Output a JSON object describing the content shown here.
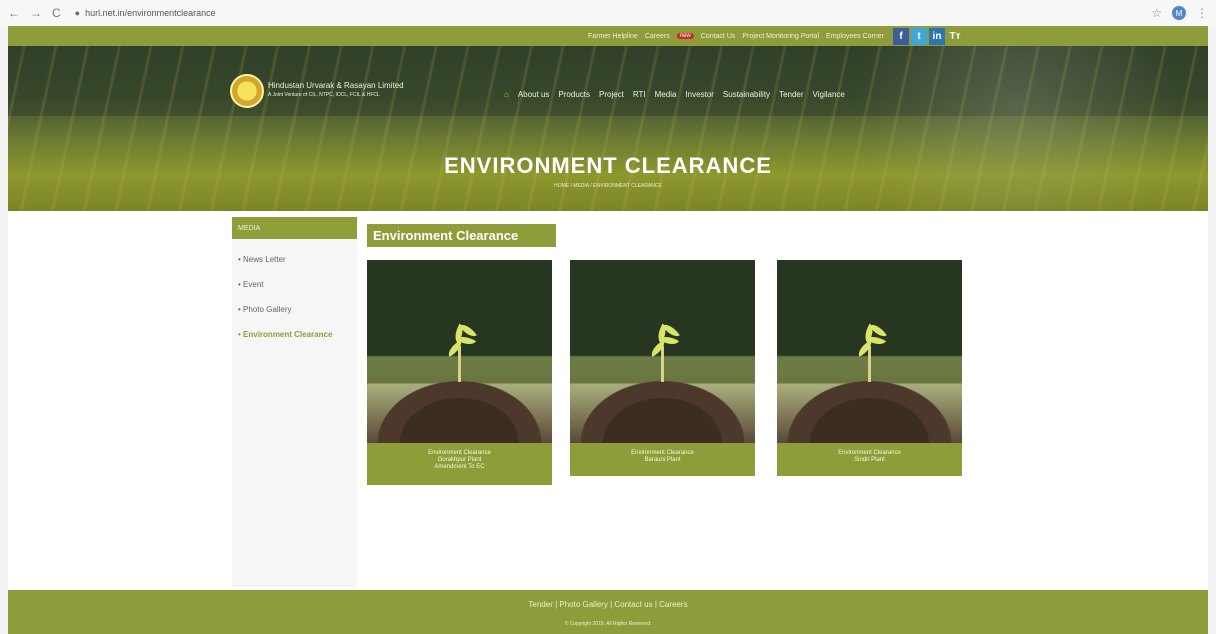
{
  "browser": {
    "url": "hurl.net.in/environmentclearance",
    "star": "☆",
    "avatar": "M",
    "menu": "⋮",
    "nav": [
      "←",
      "→",
      "C"
    ]
  },
  "topbar": {
    "items": [
      "Farmer Helpline",
      "Careers",
      "Contact Us",
      "Project Monitoring Portal",
      "Employees Corner"
    ],
    "badge": "new"
  },
  "social": {
    "facebook": "f",
    "twitter": "t",
    "linkedin": "in",
    "text": "Tт"
  },
  "company": {
    "name": "Hindustan Urvarak & Rasayan Limited",
    "tagline": "A Joint Venture of CIL, NTPC, IOCL, FCIL & HFCL"
  },
  "nav": {
    "home_icon": "⌂",
    "items": [
      "About us",
      "Products",
      "Project",
      "RTI",
      "Media",
      "Investor",
      "Sustainability",
      "Tender",
      "Vigilance"
    ]
  },
  "hero": {
    "title": "ENVIRONMENT CLEARANCE",
    "breadcrumb": "HOME / MEDIA / ENVIRONMENT CLEARANCE"
  },
  "sidebar": {
    "heading": "MEDIA",
    "items": [
      "News Letter",
      "Event",
      "Photo Gallery",
      "Environment Clearance"
    ]
  },
  "main": {
    "title": "Environment Clearance"
  },
  "cards": [
    {
      "caption": "Environment Clearance\nGorakhpur Plant\nAmendment To EC"
    },
    {
      "caption": "Environment Clearance\nBarauni Plant"
    },
    {
      "caption": "Environment Clearance\nSindri Plant"
    }
  ],
  "footer": {
    "links": "Tender | Photo Gallery | Contact us | Careers",
    "copyright": "© Copyright 2019. All Rights Reserved."
  }
}
